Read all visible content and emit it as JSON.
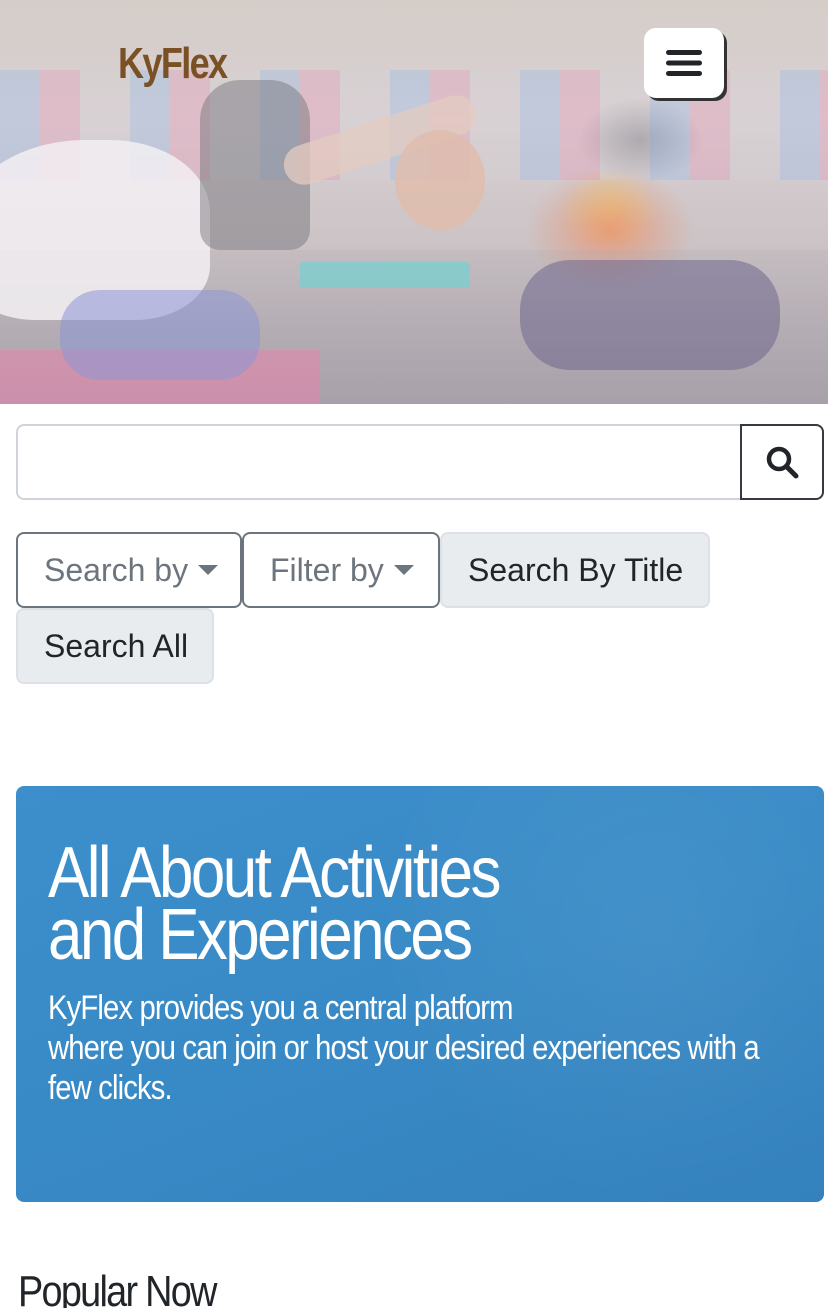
{
  "header": {
    "brand": "KyFlex",
    "menu_icon": "hamburger-menu-icon"
  },
  "search": {
    "query_value": "",
    "search_icon": "search-icon"
  },
  "filters": {
    "search_by_label": "Search by",
    "filter_by_label": "Filter by",
    "search_by_title_label": "Search By Title",
    "search_all_label": "Search All",
    "dropdown_icon": "caret-down-icon"
  },
  "jumbotron": {
    "title": "All About Activities and Experiences",
    "lines": [
      "KyFlex provides you a central platform",
      "where you can join or host your desired experiences with a few clicks."
    ],
    "background_color": "#3a8ac6"
  },
  "sections": {
    "popular_heading": "Popular Now"
  },
  "colors": {
    "brand": "#7a5124",
    "outline_button": "#6c757d",
    "light_button": "#e9ecef"
  }
}
